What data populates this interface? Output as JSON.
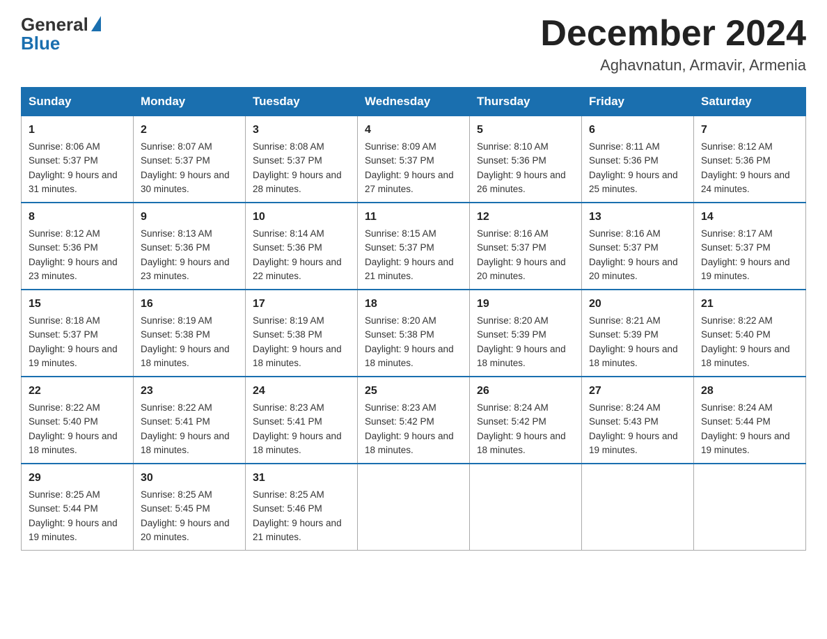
{
  "logo": {
    "general": "General",
    "blue": "Blue"
  },
  "title": "December 2024",
  "location": "Aghavnatun, Armavir, Armenia",
  "days_of_week": [
    "Sunday",
    "Monday",
    "Tuesday",
    "Wednesday",
    "Thursday",
    "Friday",
    "Saturday"
  ],
  "weeks": [
    [
      {
        "day": "1",
        "sunrise": "8:06 AM",
        "sunset": "5:37 PM",
        "daylight": "9 hours and 31 minutes."
      },
      {
        "day": "2",
        "sunrise": "8:07 AM",
        "sunset": "5:37 PM",
        "daylight": "9 hours and 30 minutes."
      },
      {
        "day": "3",
        "sunrise": "8:08 AM",
        "sunset": "5:37 PM",
        "daylight": "9 hours and 28 minutes."
      },
      {
        "day": "4",
        "sunrise": "8:09 AM",
        "sunset": "5:37 PM",
        "daylight": "9 hours and 27 minutes."
      },
      {
        "day": "5",
        "sunrise": "8:10 AM",
        "sunset": "5:36 PM",
        "daylight": "9 hours and 26 minutes."
      },
      {
        "day": "6",
        "sunrise": "8:11 AM",
        "sunset": "5:36 PM",
        "daylight": "9 hours and 25 minutes."
      },
      {
        "day": "7",
        "sunrise": "8:12 AM",
        "sunset": "5:36 PM",
        "daylight": "9 hours and 24 minutes."
      }
    ],
    [
      {
        "day": "8",
        "sunrise": "8:12 AM",
        "sunset": "5:36 PM",
        "daylight": "9 hours and 23 minutes."
      },
      {
        "day": "9",
        "sunrise": "8:13 AM",
        "sunset": "5:36 PM",
        "daylight": "9 hours and 23 minutes."
      },
      {
        "day": "10",
        "sunrise": "8:14 AM",
        "sunset": "5:36 PM",
        "daylight": "9 hours and 22 minutes."
      },
      {
        "day": "11",
        "sunrise": "8:15 AM",
        "sunset": "5:37 PM",
        "daylight": "9 hours and 21 minutes."
      },
      {
        "day": "12",
        "sunrise": "8:16 AM",
        "sunset": "5:37 PM",
        "daylight": "9 hours and 20 minutes."
      },
      {
        "day": "13",
        "sunrise": "8:16 AM",
        "sunset": "5:37 PM",
        "daylight": "9 hours and 20 minutes."
      },
      {
        "day": "14",
        "sunrise": "8:17 AM",
        "sunset": "5:37 PM",
        "daylight": "9 hours and 19 minutes."
      }
    ],
    [
      {
        "day": "15",
        "sunrise": "8:18 AM",
        "sunset": "5:37 PM",
        "daylight": "9 hours and 19 minutes."
      },
      {
        "day": "16",
        "sunrise": "8:19 AM",
        "sunset": "5:38 PM",
        "daylight": "9 hours and 18 minutes."
      },
      {
        "day": "17",
        "sunrise": "8:19 AM",
        "sunset": "5:38 PM",
        "daylight": "9 hours and 18 minutes."
      },
      {
        "day": "18",
        "sunrise": "8:20 AM",
        "sunset": "5:38 PM",
        "daylight": "9 hours and 18 minutes."
      },
      {
        "day": "19",
        "sunrise": "8:20 AM",
        "sunset": "5:39 PM",
        "daylight": "9 hours and 18 minutes."
      },
      {
        "day": "20",
        "sunrise": "8:21 AM",
        "sunset": "5:39 PM",
        "daylight": "9 hours and 18 minutes."
      },
      {
        "day": "21",
        "sunrise": "8:22 AM",
        "sunset": "5:40 PM",
        "daylight": "9 hours and 18 minutes."
      }
    ],
    [
      {
        "day": "22",
        "sunrise": "8:22 AM",
        "sunset": "5:40 PM",
        "daylight": "9 hours and 18 minutes."
      },
      {
        "day": "23",
        "sunrise": "8:22 AM",
        "sunset": "5:41 PM",
        "daylight": "9 hours and 18 minutes."
      },
      {
        "day": "24",
        "sunrise": "8:23 AM",
        "sunset": "5:41 PM",
        "daylight": "9 hours and 18 minutes."
      },
      {
        "day": "25",
        "sunrise": "8:23 AM",
        "sunset": "5:42 PM",
        "daylight": "9 hours and 18 minutes."
      },
      {
        "day": "26",
        "sunrise": "8:24 AM",
        "sunset": "5:42 PM",
        "daylight": "9 hours and 18 minutes."
      },
      {
        "day": "27",
        "sunrise": "8:24 AM",
        "sunset": "5:43 PM",
        "daylight": "9 hours and 19 minutes."
      },
      {
        "day": "28",
        "sunrise": "8:24 AM",
        "sunset": "5:44 PM",
        "daylight": "9 hours and 19 minutes."
      }
    ],
    [
      {
        "day": "29",
        "sunrise": "8:25 AM",
        "sunset": "5:44 PM",
        "daylight": "9 hours and 19 minutes."
      },
      {
        "day": "30",
        "sunrise": "8:25 AM",
        "sunset": "5:45 PM",
        "daylight": "9 hours and 20 minutes."
      },
      {
        "day": "31",
        "sunrise": "8:25 AM",
        "sunset": "5:46 PM",
        "daylight": "9 hours and 21 minutes."
      },
      null,
      null,
      null,
      null
    ]
  ]
}
